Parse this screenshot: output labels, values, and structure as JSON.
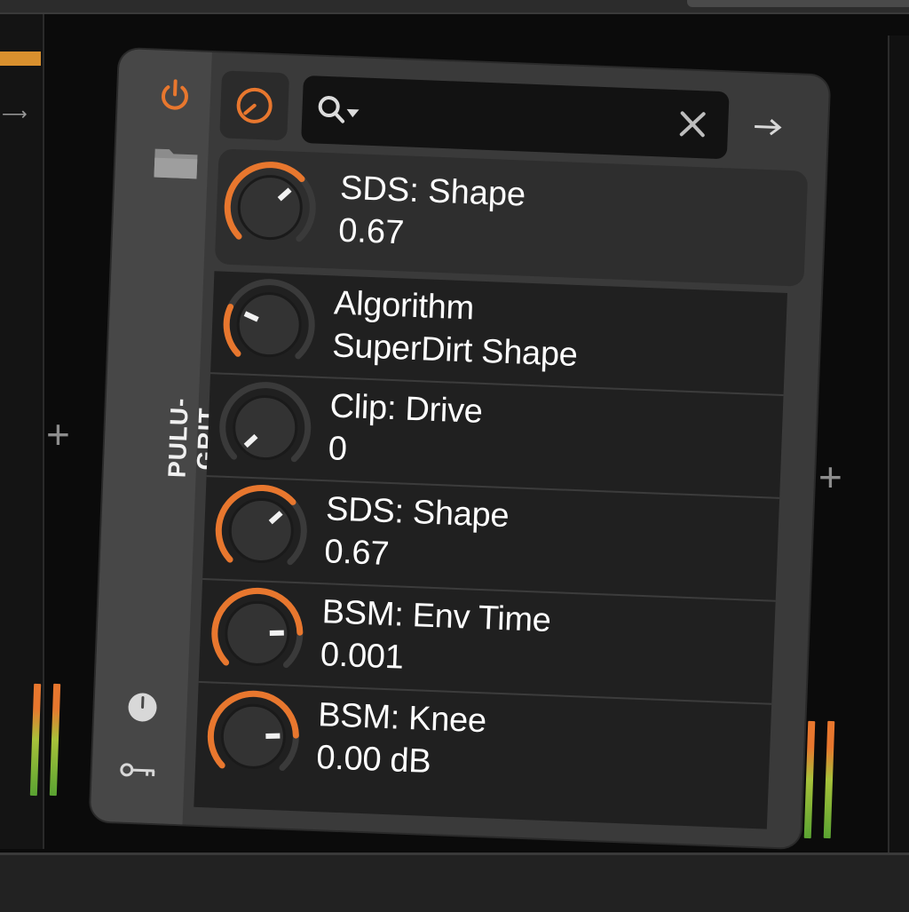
{
  "device": {
    "title": "PULU-GRIT",
    "search": {
      "value": "",
      "placeholder": ""
    }
  },
  "focused_param": {
    "label": "SDS: Shape",
    "value": "0.67",
    "level": 0.67
  },
  "params": [
    {
      "label": "Algorithm",
      "value": "SuperDirt Shape",
      "level": 0.25
    },
    {
      "label": "Clip: Drive",
      "value": "0",
      "level": 0.0
    },
    {
      "label": "SDS: Shape",
      "value": "0.67",
      "level": 0.67
    },
    {
      "label": "BSM: Env Time",
      "value": "0.001",
      "level": 0.82
    },
    {
      "label": "BSM: Knee",
      "value": "0.00 dB",
      "level": 0.82
    }
  ],
  "colors": {
    "accent": "#e8772e",
    "knob_track": "#3a3a3a",
    "knob_face": "#333333",
    "indicator": "#f2f2f2"
  },
  "icons": [
    "power-icon",
    "folder-icon",
    "knob-icon",
    "search-icon",
    "clear-icon",
    "arrow-right-icon",
    "plus-icon",
    "clock-icon",
    "key-icon"
  ]
}
